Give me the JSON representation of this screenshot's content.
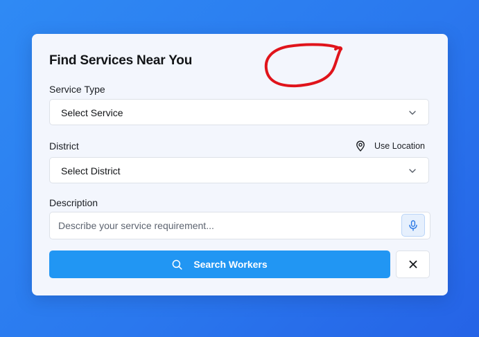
{
  "form": {
    "title": "Find Services Near You",
    "service_type": {
      "label": "Service Type",
      "selected": "Select Service",
      "icon": "chevron-down-icon"
    },
    "district": {
      "label": "District",
      "selected": "Select District",
      "icon": "chevron-down-icon",
      "use_location_label": "Use Location",
      "use_location_icon": "map-pin-icon"
    },
    "description": {
      "label": "Description",
      "placeholder": "Describe your service requirement...",
      "value": "",
      "mic_icon": "microphone-icon"
    },
    "search_button": {
      "label": "Search Workers",
      "icon": "search-icon"
    },
    "clear_button": {
      "icon": "close-icon"
    }
  },
  "colors": {
    "background_gradient": [
      "#2f8af4",
      "#2563e6"
    ],
    "card": "#f3f6fd",
    "primary": "#2196f3",
    "annotation": "#e0141b"
  }
}
